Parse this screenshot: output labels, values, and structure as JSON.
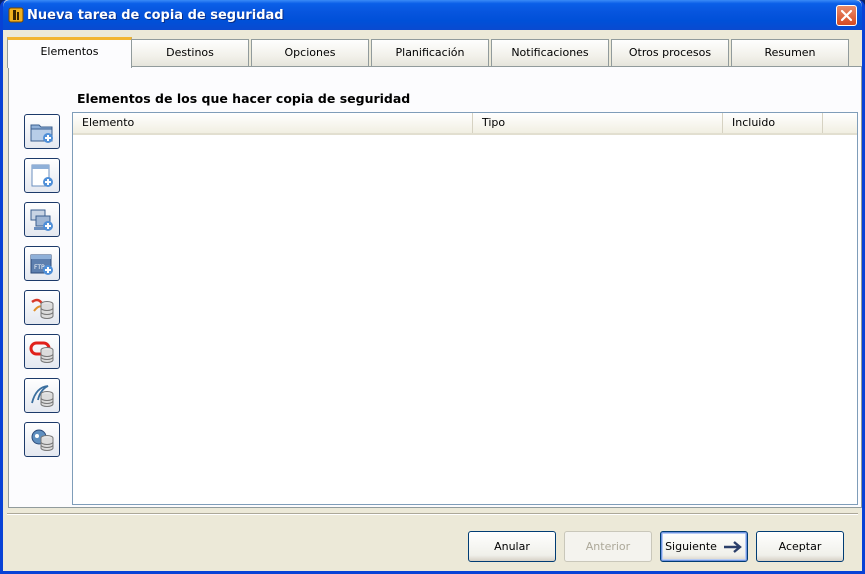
{
  "window": {
    "title": "Nueva tarea de copia de seguridad"
  },
  "tabs": [
    {
      "label": "Elementos",
      "active": true
    },
    {
      "label": "Destinos",
      "active": false
    },
    {
      "label": "Opciones",
      "active": false
    },
    {
      "label": "Planificación",
      "active": false
    },
    {
      "label": "Notificaciones",
      "active": false
    },
    {
      "label": "Otros procesos",
      "active": false
    },
    {
      "label": "Resumen",
      "active": false
    }
  ],
  "sidebar": {
    "buttons": [
      {
        "icon": "add-folder-icon"
      },
      {
        "icon": "add-file-icon"
      },
      {
        "icon": "add-network-icon"
      },
      {
        "icon": "add-ftp-icon"
      },
      {
        "icon": "sql-server-database-icon"
      },
      {
        "icon": "oracle-database-icon"
      },
      {
        "icon": "mysql-database-icon"
      },
      {
        "icon": "postgresql-database-icon"
      }
    ]
  },
  "main": {
    "heading": "Elementos de los que hacer copia de seguridad",
    "columns": [
      "Elemento",
      "Tipo",
      "Incluido"
    ],
    "ftp_badge": "FTP"
  },
  "footer": {
    "cancel_label": "Anular",
    "previous_label": "Anterior",
    "next_label": "Siguiente",
    "accept_label": "Aceptar"
  },
  "colors": {
    "titlebar": "#0755de",
    "tab_active_accent": "#f2b531",
    "window_bg": "#ece9d8"
  }
}
